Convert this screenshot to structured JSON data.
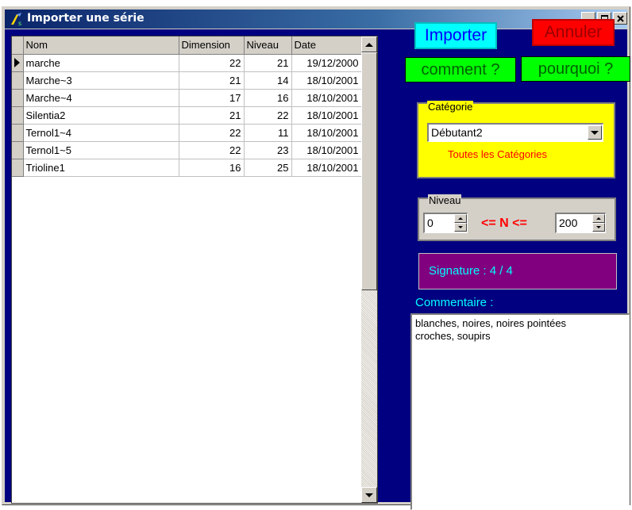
{
  "window": {
    "title": "Importer une série"
  },
  "table": {
    "columns": [
      "Nom",
      "Dimension",
      "Niveau",
      "Date"
    ],
    "rows": [
      {
        "nom": "marche",
        "dimension": "22",
        "niveau": "21",
        "date": "19/12/2000"
      },
      {
        "nom": "Marche~3",
        "dimension": "21",
        "niveau": "14",
        "date": "18/10/2001"
      },
      {
        "nom": "Marche~4",
        "dimension": "17",
        "niveau": "16",
        "date": "18/10/2001"
      },
      {
        "nom": "Silentia2",
        "dimension": "21",
        "niveau": "22",
        "date": "18/10/2001"
      },
      {
        "nom": "Ternol1~4",
        "dimension": "22",
        "niveau": "11",
        "date": "18/10/2001"
      },
      {
        "nom": "Ternol1~5",
        "dimension": "22",
        "niveau": "23",
        "date": "18/10/2001"
      },
      {
        "nom": "Trioline1",
        "dimension": "16",
        "niveau": "25",
        "date": "18/10/2001"
      }
    ]
  },
  "buttons": {
    "importer": "Importer",
    "annuler": "Annuler",
    "comment": "comment ?",
    "pourquoi": "pourquoi  ?"
  },
  "categorie": {
    "label": "Catégorie",
    "selected": "Débutant2",
    "all_link": "Toutes les Catégories"
  },
  "niveau": {
    "label": "Niveau",
    "min": "0",
    "max": "200",
    "relation": "<=  N  <="
  },
  "signature": "Signature : 4 / 4",
  "commentaire": {
    "label": "Commentaire :",
    "lines": [
      "blanches, noires, noires pointées",
      "croches, soupirs"
    ]
  },
  "colors": {
    "client_bg": "#000080",
    "import_bg": "#00ffff",
    "cancel_bg": "#ff0000",
    "help_bg": "#00ff00",
    "categorie_bg": "#ffff00",
    "signature_bg": "#800080"
  }
}
